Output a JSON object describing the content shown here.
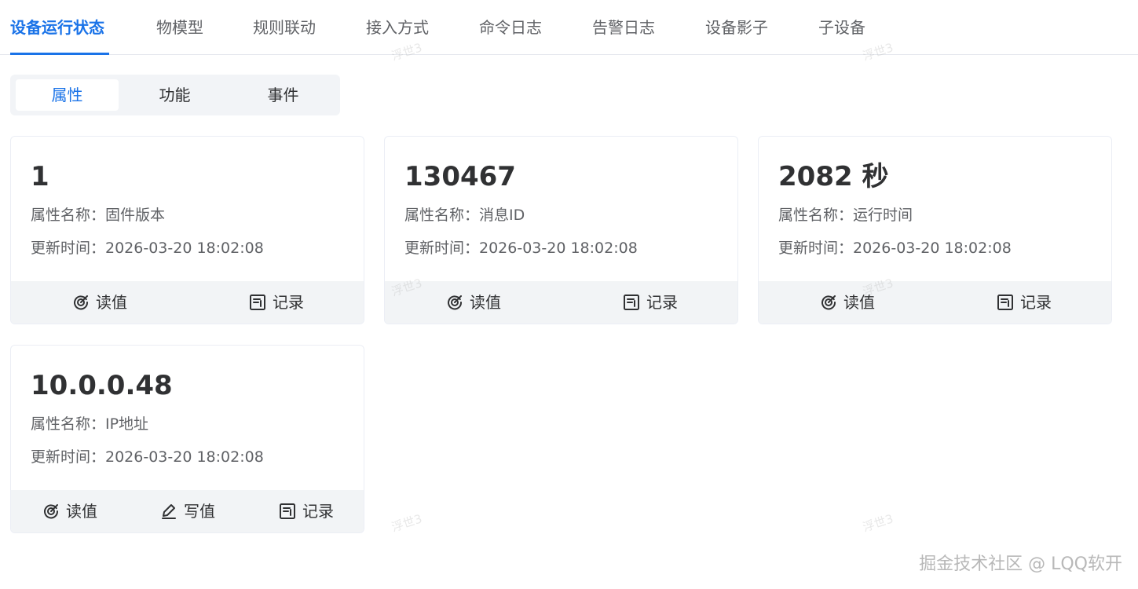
{
  "tabs": [
    {
      "label": "设备运行状态",
      "active": true
    },
    {
      "label": "物模型"
    },
    {
      "label": "规则联动"
    },
    {
      "label": "接入方式"
    },
    {
      "label": "命令日志"
    },
    {
      "label": "告警日志"
    },
    {
      "label": "设备影子"
    },
    {
      "label": "子设备"
    }
  ],
  "segments": [
    {
      "label": "属性",
      "active": true
    },
    {
      "label": "功能"
    },
    {
      "label": "事件"
    }
  ],
  "cards": [
    {
      "value": "1",
      "name_label": "属性名称：固件版本",
      "time_label": "更新时间：2026-03-20 18:02:08",
      "actions": {
        "read": "读值",
        "record": "记录"
      }
    },
    {
      "value": "130467",
      "name_label": "属性名称：消息ID",
      "time_label": "更新时间：2026-03-20 18:02:08",
      "actions": {
        "read": "读值",
        "record": "记录"
      }
    },
    {
      "value": "2082 秒",
      "name_label": "属性名称：运行时间",
      "time_label": "更新时间：2026-03-20 18:02:08",
      "actions": {
        "read": "读值",
        "record": "记录"
      }
    },
    {
      "value": "10.0.0.48",
      "name_label": "属性名称：IP地址",
      "time_label": "更新时间：2026-03-20 18:02:08",
      "actions": {
        "read": "读值",
        "write": "写值",
        "record": "记录"
      }
    }
  ],
  "watermark": "浮世3",
  "footer": "掘金技术社区 @ LQQ软开",
  "colors": {
    "accent": "#1a73e8",
    "text_primary": "#303133",
    "text_secondary": "#606266",
    "action_bar": "#f2f4f6",
    "segment_bg": "#f2f4f7"
  },
  "icons": {
    "read": "read-value-icon",
    "write": "write-value-icon",
    "record": "record-icon"
  }
}
